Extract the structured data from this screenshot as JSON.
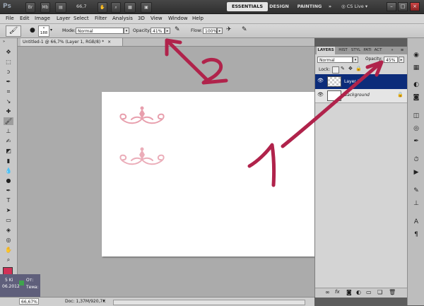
{
  "app": {
    "logo": "Ps",
    "zoom": "66,7",
    "workspaces": [
      "ESSENTIALS",
      "DESIGN",
      "PAINTING",
      "»"
    ],
    "cs_live": "CS Live"
  },
  "menu": [
    "File",
    "Edit",
    "Image",
    "Layer",
    "Select",
    "Filter",
    "Analysis",
    "3D",
    "View",
    "Window",
    "Help"
  ],
  "options": {
    "brush_size": "188",
    "mode_label": "Mode:",
    "mode_value": "Normal",
    "opacity_label": "Opacity:",
    "opacity_value": "41%",
    "flow_label": "Flow:",
    "flow_value": "100%"
  },
  "document": {
    "tab_title": "Untitled-1 @ 66,7% (Layer 1, RGB/8) *",
    "close": "×"
  },
  "layers_panel": {
    "tabs": [
      "LAYERS",
      "HIST",
      "STYL",
      "PATI",
      "ACT"
    ],
    "blend_mode": "Normal",
    "opacity_label": "Opacity:",
    "opacity_value": "45%",
    "lock_label": "Lock:",
    "layers": [
      {
        "name": "Layer 1",
        "selected": true
      },
      {
        "name": "Background",
        "selected": false
      }
    ]
  },
  "statusbar": {
    "zoom": "66,67%",
    "docinfo": "Doc: 1,37M/920,7K"
  },
  "taskbar": {
    "time_line1": "5 Ki",
    "time_line2": "06.2012",
    "msg_line1": "От:",
    "msg_line2": "Тема:"
  },
  "annotations": {
    "label_1": "1",
    "label_2": "2"
  },
  "colors": {
    "ornament": "#e89fad",
    "annotation": "#b0234b",
    "selected_layer": "#0c2c7a",
    "foreground": "#d13257"
  },
  "icons": [
    "brush-icon",
    "eye-icon",
    "lock-icon",
    "layer-link-icon",
    "fx-icon",
    "mask-icon",
    "adjustment-icon",
    "folder-icon",
    "new-layer-icon",
    "trash-icon"
  ]
}
